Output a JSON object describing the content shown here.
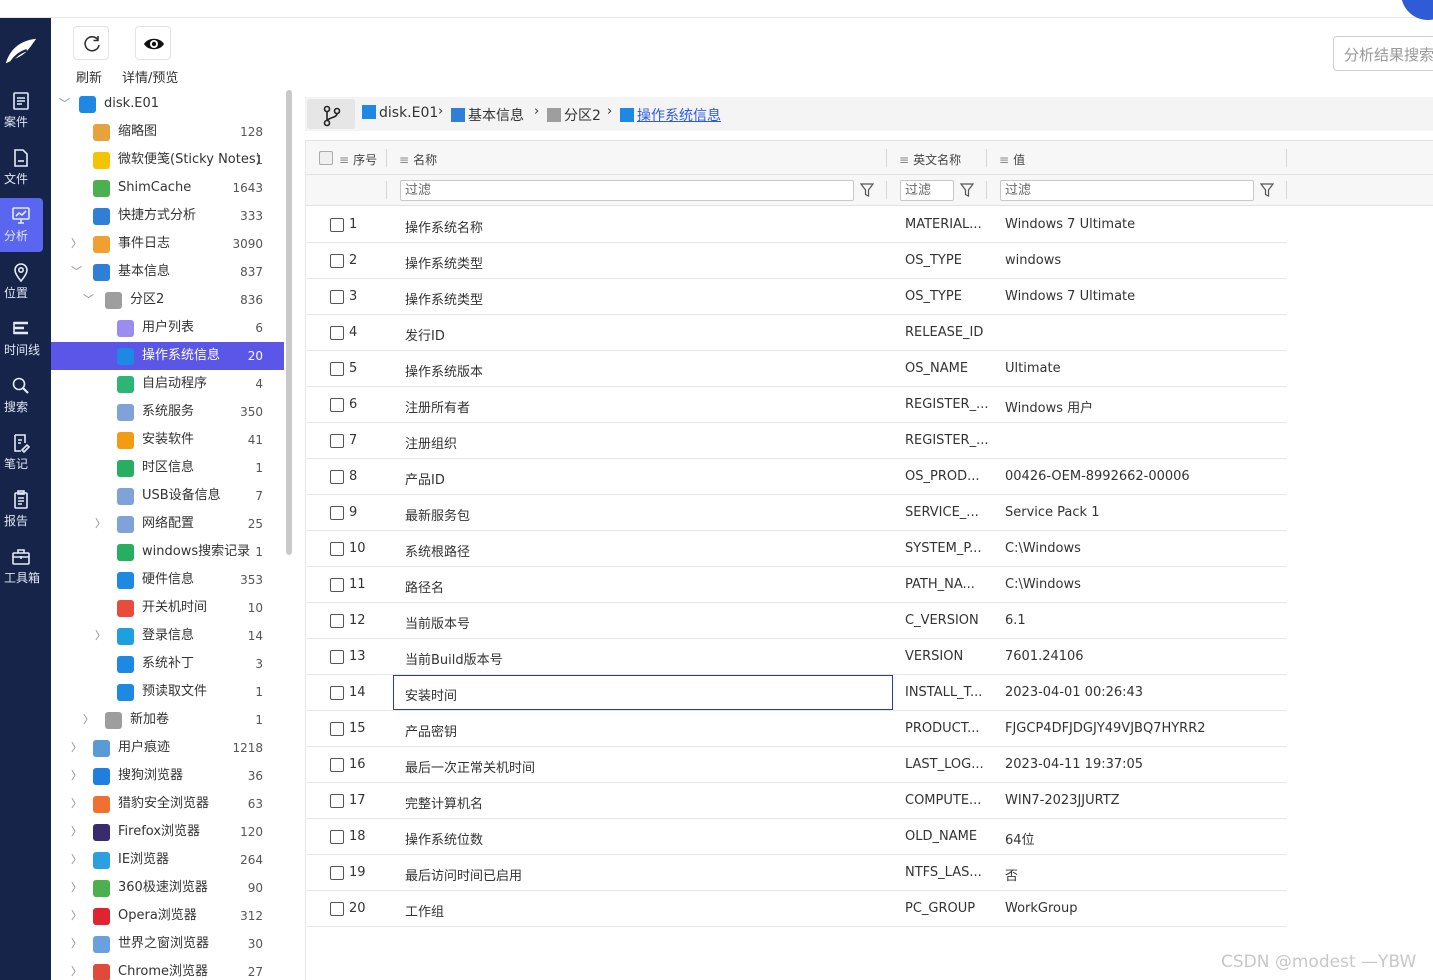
{
  "rail": [
    {
      "icon": "case-icon",
      "label": "案件"
    },
    {
      "icon": "file-icon",
      "label": "文件"
    },
    {
      "icon": "analysis-icon",
      "label": "分析",
      "active": true
    },
    {
      "icon": "location-icon",
      "label": "位置"
    },
    {
      "icon": "timeline-icon",
      "label": "时间线"
    },
    {
      "icon": "search-icon",
      "label": "搜索"
    },
    {
      "icon": "note-icon",
      "label": "笔记"
    },
    {
      "icon": "report-icon",
      "label": "报告"
    },
    {
      "icon": "toolbox-icon",
      "label": "工具箱"
    }
  ],
  "toolbar": {
    "refresh_label": "刷新",
    "detail_label": "详情/预览",
    "search_placeholder": "分析结果搜索"
  },
  "tree": [
    {
      "label": "disk.E01",
      "count": "",
      "depth": 0,
      "expand": "open",
      "icon": "windows-icon",
      "color": "#1e88e5"
    },
    {
      "label": "缩略图",
      "count": "128",
      "depth": 1,
      "expand": "",
      "icon": "thumbnail-icon",
      "color": "#e6a23c"
    },
    {
      "label": "微软便笺(Sticky Notes)",
      "count": "1",
      "depth": 1,
      "expand": "",
      "icon": "sticky-notes-icon",
      "color": "#f5c400"
    },
    {
      "label": "ShimCache",
      "count": "1643",
      "depth": 1,
      "expand": "",
      "icon": "shimcache-icon",
      "color": "#4caf50"
    },
    {
      "label": "快捷方式分析",
      "count": "333",
      "depth": 1,
      "expand": "",
      "icon": "shortcut-icon",
      "color": "#2f7fd6"
    },
    {
      "label": "事件日志",
      "count": "3090",
      "depth": 1,
      "expand": "closed",
      "icon": "event-log-icon",
      "color": "#f0a030"
    },
    {
      "label": "基本信息",
      "count": "837",
      "depth": 1,
      "expand": "open",
      "icon": "basic-info-icon",
      "color": "#2f7fd6"
    },
    {
      "label": "分区2",
      "count": "836",
      "depth": 2,
      "expand": "open",
      "icon": "partition-icon",
      "color": "#9e9e9e"
    },
    {
      "label": "用户列表",
      "count": "6",
      "depth": 3,
      "expand": "",
      "icon": "user-list-icon",
      "color": "#9b8cf0"
    },
    {
      "label": "操作系统信息",
      "count": "20",
      "depth": 3,
      "expand": "",
      "icon": "os-info-icon",
      "color": "#1e88e5",
      "selected": true
    },
    {
      "label": "自启动程序",
      "count": "4",
      "depth": 3,
      "expand": "",
      "icon": "autostart-icon",
      "color": "#2bb673"
    },
    {
      "label": "系统服务",
      "count": "350",
      "depth": 3,
      "expand": "",
      "icon": "service-icon",
      "color": "#7fa3d8"
    },
    {
      "label": "安装软件",
      "count": "41",
      "depth": 3,
      "expand": "",
      "icon": "software-icon",
      "color": "#f39c12"
    },
    {
      "label": "时区信息",
      "count": "1",
      "depth": 3,
      "expand": "",
      "icon": "timezone-icon",
      "color": "#27ae60"
    },
    {
      "label": "USB设备信息",
      "count": "7",
      "depth": 3,
      "expand": "",
      "icon": "usb-icon",
      "color": "#7fa3d8"
    },
    {
      "label": "网络配置",
      "count": "25",
      "depth": 3,
      "expand": "closed",
      "icon": "network-icon",
      "color": "#7fa3d8"
    },
    {
      "label": "windows搜索记录",
      "count": "1",
      "depth": 3,
      "expand": "",
      "icon": "search-record-icon",
      "color": "#27ae60"
    },
    {
      "label": "硬件信息",
      "count": "353",
      "depth": 3,
      "expand": "",
      "icon": "hardware-icon",
      "color": "#1e88e5"
    },
    {
      "label": "开关机时间",
      "count": "10",
      "depth": 3,
      "expand": "",
      "icon": "power-icon",
      "color": "#e74c3c"
    },
    {
      "label": "登录信息",
      "count": "14",
      "depth": 3,
      "expand": "closed",
      "icon": "login-icon",
      "color": "#1ea0e0"
    },
    {
      "label": "系统补丁",
      "count": "3",
      "depth": 3,
      "expand": "",
      "icon": "patch-icon",
      "color": "#1e88e5"
    },
    {
      "label": "预读取文件",
      "count": "1",
      "depth": 3,
      "expand": "",
      "icon": "prefetch-icon",
      "color": "#1e88e5"
    },
    {
      "label": "新加卷",
      "count": "1",
      "depth": 2,
      "expand": "closed",
      "icon": "volume-icon",
      "color": "#9e9e9e"
    },
    {
      "label": "用户痕迹",
      "count": "1218",
      "depth": 1,
      "expand": "closed",
      "icon": "user-trace-icon",
      "color": "#5b9bd5"
    },
    {
      "label": "搜狗浏览器",
      "count": "36",
      "depth": 1,
      "expand": "closed",
      "icon": "sogou-browser-icon",
      "color": "#1e7fe0"
    },
    {
      "label": "猎豹安全浏览器",
      "count": "63",
      "depth": 1,
      "expand": "closed",
      "icon": "liebao-browser-icon",
      "color": "#f07030"
    },
    {
      "label": "Firefox浏览器",
      "count": "120",
      "depth": 1,
      "expand": "closed",
      "icon": "firefox-icon",
      "color": "#3a2a6e"
    },
    {
      "label": "IE浏览器",
      "count": "264",
      "depth": 1,
      "expand": "closed",
      "icon": "ie-icon",
      "color": "#2aa0e0"
    },
    {
      "label": "360极速浏览器",
      "count": "90",
      "depth": 1,
      "expand": "closed",
      "icon": "360-browser-icon",
      "color": "#4caf50"
    },
    {
      "label": "Opera浏览器",
      "count": "312",
      "depth": 1,
      "expand": "closed",
      "icon": "opera-icon",
      "color": "#e0242f"
    },
    {
      "label": "世界之窗浏览器",
      "count": "30",
      "depth": 1,
      "expand": "closed",
      "icon": "theworld-browser-icon",
      "color": "#6aa0e0"
    },
    {
      "label": "Chrome浏览器",
      "count": "27",
      "depth": 1,
      "expand": "closed",
      "icon": "chrome-icon",
      "color": "#e04a3a"
    }
  ],
  "breadcrumb": [
    {
      "label": "disk.E01",
      "icon": "windows-icon"
    },
    {
      "label": "基本信息",
      "icon": "basic-info-icon"
    },
    {
      "label": "分区2",
      "icon": "partition-icon"
    },
    {
      "label": "操作系统信息",
      "icon": "os-info-icon",
      "current": true
    }
  ],
  "table": {
    "headers": {
      "index": "序号",
      "name": "名称",
      "en_name": "英文名称",
      "value": "值"
    },
    "filter_placeholder": "过滤",
    "rows": [
      {
        "n": "1",
        "name": "操作系统名称",
        "en": "MATERIAL...",
        "val": "Windows 7 Ultimate"
      },
      {
        "n": "2",
        "name": "操作系统类型",
        "en": "OS_TYPE",
        "val": "windows"
      },
      {
        "n": "3",
        "name": "操作系统类型",
        "en": "OS_TYPE",
        "val": "Windows 7 Ultimate"
      },
      {
        "n": "4",
        "name": "发行ID",
        "en": "RELEASE_ID",
        "val": ""
      },
      {
        "n": "5",
        "name": "操作系统版本",
        "en": "OS_NAME",
        "val": "Ultimate"
      },
      {
        "n": "6",
        "name": "注册所有者",
        "en": "REGISTER_...",
        "val": "Windows 用户"
      },
      {
        "n": "7",
        "name": "注册组织",
        "en": "REGISTER_...",
        "val": ""
      },
      {
        "n": "8",
        "name": "产品ID",
        "en": "OS_PROD...",
        "val": "00426-OEM-8992662-00006"
      },
      {
        "n": "9",
        "name": "最新服务包",
        "en": "SERVICE_...",
        "val": "Service Pack 1"
      },
      {
        "n": "10",
        "name": "系统根路径",
        "en": "SYSTEM_P...",
        "val": "C:\\Windows"
      },
      {
        "n": "11",
        "name": "路径名",
        "en": "PATH_NA...",
        "val": "C:\\Windows"
      },
      {
        "n": "12",
        "name": "当前版本号",
        "en": "C_VERSION",
        "val": "6.1"
      },
      {
        "n": "13",
        "name": "当前Build版本号",
        "en": "VERSION",
        "val": "7601.24106"
      },
      {
        "n": "14",
        "name": "安装时间",
        "en": "INSTALL_T...",
        "val": "2023-04-01 00:26:43",
        "focused": true
      },
      {
        "n": "15",
        "name": "产品密钥",
        "en": "PRODUCT...",
        "val": "FJGCP4DFJDGJY49VJBQ7HYRR2"
      },
      {
        "n": "16",
        "name": "最后一次正常关机时间",
        "en": "LAST_LOG...",
        "val": "2023-04-11 19:37:05"
      },
      {
        "n": "17",
        "name": "完整计算机名",
        "en": "COMPUTE...",
        "val": "WIN7-2023JJURTZ"
      },
      {
        "n": "18",
        "name": "操作系统位数",
        "en": "OLD_NAME",
        "val": "64位"
      },
      {
        "n": "19",
        "name": "最后访问时间已启用",
        "en": "NTFS_LAS...",
        "val": "否"
      },
      {
        "n": "20",
        "name": "工作组",
        "en": "PC_GROUP",
        "val": "WorkGroup"
      }
    ]
  },
  "watermark": "CSDN @modest —YBW"
}
